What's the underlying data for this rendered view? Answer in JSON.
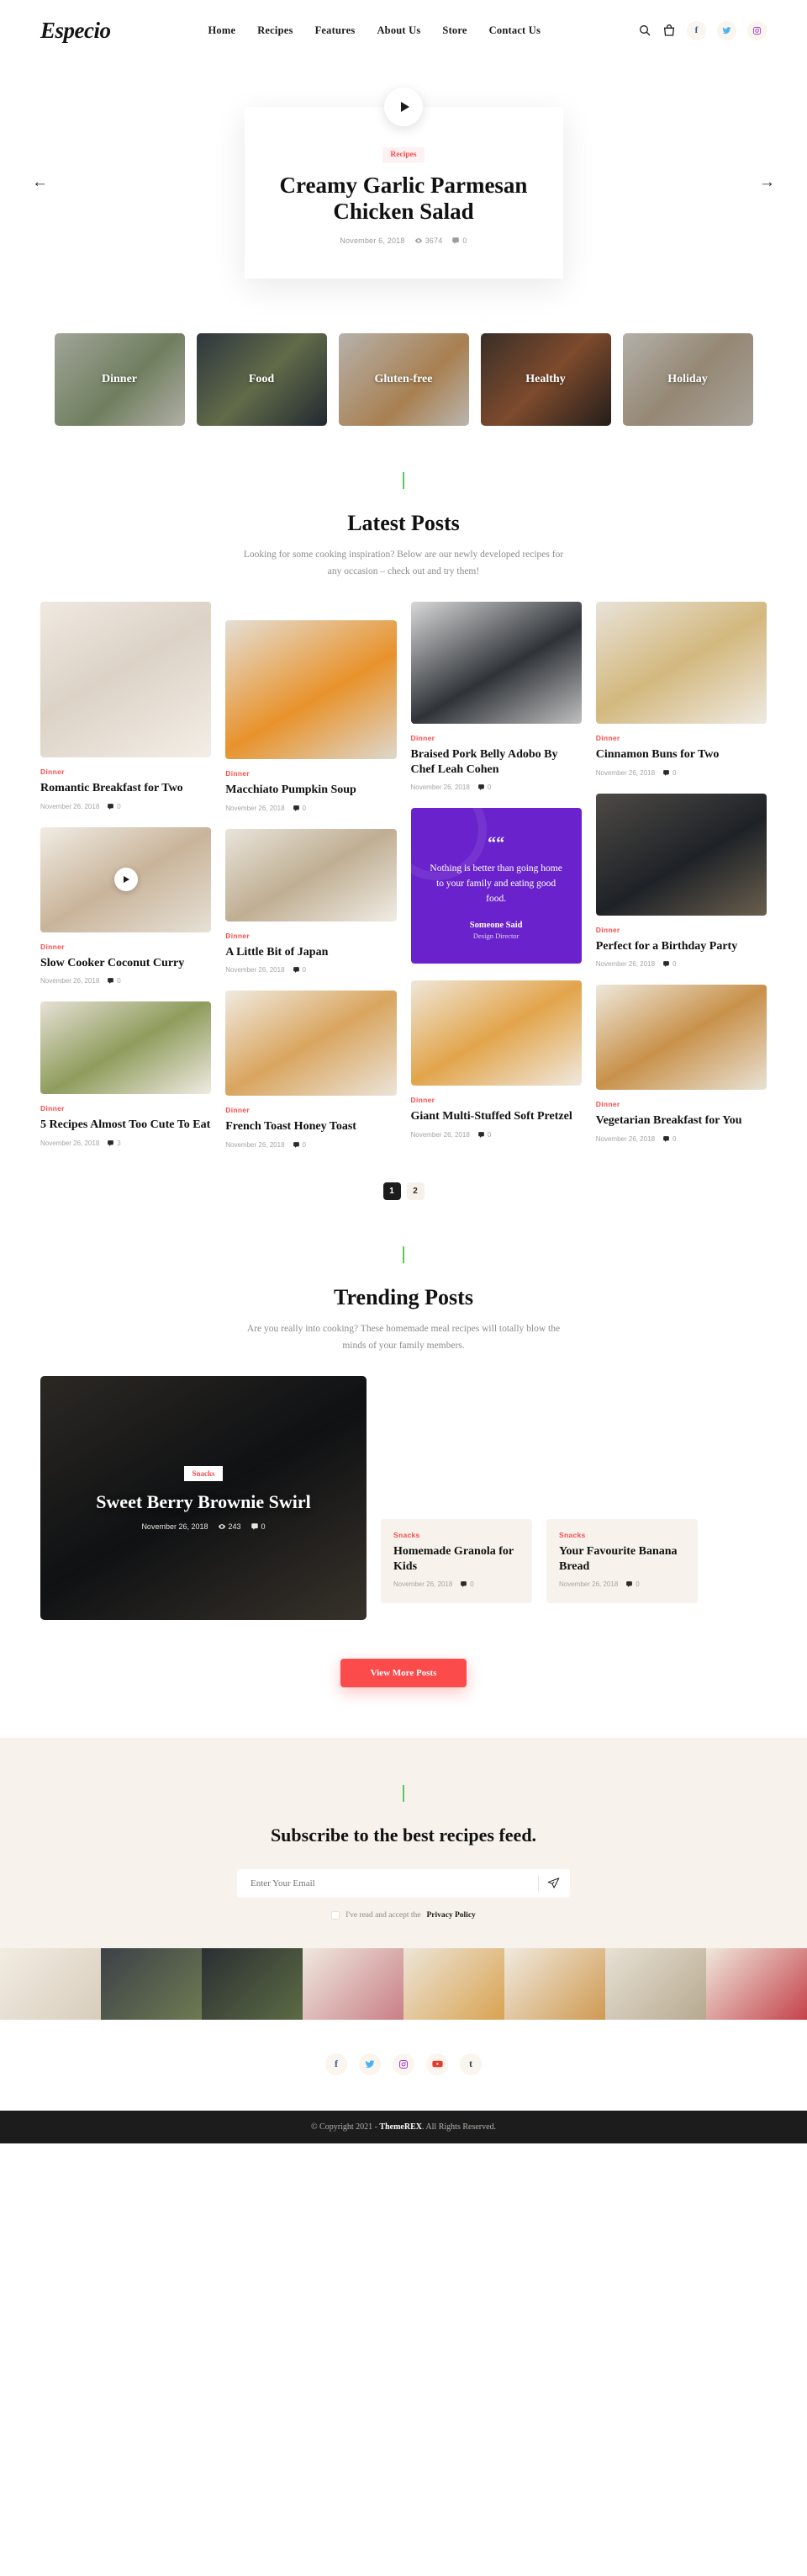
{
  "site": {
    "logo": "Especio"
  },
  "header": {
    "nav": [
      {
        "label": "Home"
      },
      {
        "label": "Recipes"
      },
      {
        "label": "Features"
      },
      {
        "label": "About Us"
      },
      {
        "label": "Store"
      },
      {
        "label": "Contact Us"
      }
    ],
    "icons": [
      {
        "name": "search-icon"
      },
      {
        "name": "shopping-bag-icon"
      }
    ],
    "social": [
      {
        "name": "facebook-icon",
        "glyph": "f",
        "color": "#3b5998"
      },
      {
        "name": "twitter-icon",
        "glyph": "ᴛ",
        "color": "#4ab3f4"
      },
      {
        "name": "instagram-icon",
        "glyph": "□",
        "color": "#a238c9"
      }
    ]
  },
  "hero": {
    "prev_arrow": "←",
    "next_arrow": "→",
    "category": "Recipes",
    "title": "Creamy Garlic Parmesan Chicken Salad",
    "date": "November 6, 2018",
    "views": "3674",
    "comments": "0"
  },
  "categories": [
    {
      "label": "Dinner"
    },
    {
      "label": "Food"
    },
    {
      "label": "Gluten-free"
    },
    {
      "label": "Healthy"
    },
    {
      "label": "Holiday"
    }
  ],
  "latest": {
    "title": "Latest Posts",
    "subtitle": "Looking for some cooking inspiration? Below are our newly developed recipes for any occasion – check out and try them!",
    "posts": [
      {
        "category": "Dinner",
        "title": "Romantic Breakfast for Two",
        "date": "November 26, 2018",
        "comments": "0"
      },
      {
        "category": "Dinner",
        "title": "Macchiato Pumpkin Soup",
        "date": "November 26, 2018",
        "comments": "0"
      },
      {
        "category": "Dinner",
        "title": "Braised Pork Belly Adobo By Chef Leah Cohen",
        "date": "November 26, 2018",
        "comments": "0"
      },
      {
        "category": "Dinner",
        "title": "Cinnamon Buns for Two",
        "date": "November 26, 2018",
        "comments": "0"
      },
      {
        "category": "Dinner",
        "title": "Slow Cooker Coconut Curry",
        "date": "November 26, 2018",
        "comments": "0"
      },
      {
        "category": "Dinner",
        "title": "A Little Bit of Japan",
        "date": "November 26, 2018",
        "comments": "0"
      },
      {
        "category": "Dinner",
        "title": "Perfect for a Birthday Party",
        "date": "November 26, 2018",
        "comments": "0"
      },
      {
        "category": "Dinner",
        "title": "5 Recipes Almost Too Cute To Eat",
        "date": "November 26, 2018",
        "comments": "3"
      },
      {
        "category": "Dinner",
        "title": "French Toast Honey Toast",
        "date": "November 26, 2018",
        "comments": "0"
      },
      {
        "category": "Dinner",
        "title": "Giant Multi-Stuffed Soft Pretzel",
        "date": "November 26, 2018",
        "comments": "0"
      },
      {
        "category": "Dinner",
        "title": "Vegetarian Breakfast for You",
        "date": "November 26, 2018",
        "comments": "0"
      }
    ],
    "quote": {
      "mark": "““",
      "text": "Nothing is better than going home to your family and eating good food.",
      "author": "Someone Said",
      "role": "Design Director",
      "color": "#6a23cc"
    },
    "pagination": [
      {
        "label": "1",
        "active": true
      },
      {
        "label": "2",
        "active": false
      }
    ]
  },
  "trending": {
    "title": "Trending Posts",
    "subtitle": "Are you really into cooking? These homemade meal recipes will totally blow the minds of your family members.",
    "feature": {
      "category": "Snacks",
      "title": "Sweet Berry Brownie Swirl",
      "date": "November 26, 2018",
      "views": "243",
      "comments": "0"
    },
    "cards": [
      {
        "category": "Snacks",
        "title": "Homemade Granola for Kids",
        "date": "November 26, 2018",
        "comments": "0"
      },
      {
        "category": "Snacks",
        "title": "Your Favourite Banana Bread",
        "date": "November 26, 2018",
        "comments": "0"
      }
    ],
    "cta": "View More Posts",
    "cta_color": "#fb4b4b"
  },
  "subscribe": {
    "title": "Subscribe to the best recipes feed.",
    "placeholder": "Enter Your Email",
    "value": "",
    "send_icon": "send-icon",
    "privacy_pre": "I've read and accept the ",
    "privacy_link": "Privacy Policy"
  },
  "footer": {
    "social": [
      {
        "name": "facebook-icon",
        "glyph": "f",
        "cls": "soc-fb"
      },
      {
        "name": "twitter-icon",
        "glyph": "ᴛ",
        "cls": "soc-tw"
      },
      {
        "name": "instagram-icon",
        "glyph": "□",
        "cls": "soc-ig"
      },
      {
        "name": "youtube-icon",
        "glyph": "▶",
        "cls": "soc-yt"
      },
      {
        "name": "tumblr-icon",
        "glyph": "t",
        "cls": "soc-tb"
      }
    ],
    "copyright_pre": "© Copyright 2021 - ",
    "copyright_brand": "ThemeREX",
    "copyright_post": ". All Rights Reserved."
  }
}
